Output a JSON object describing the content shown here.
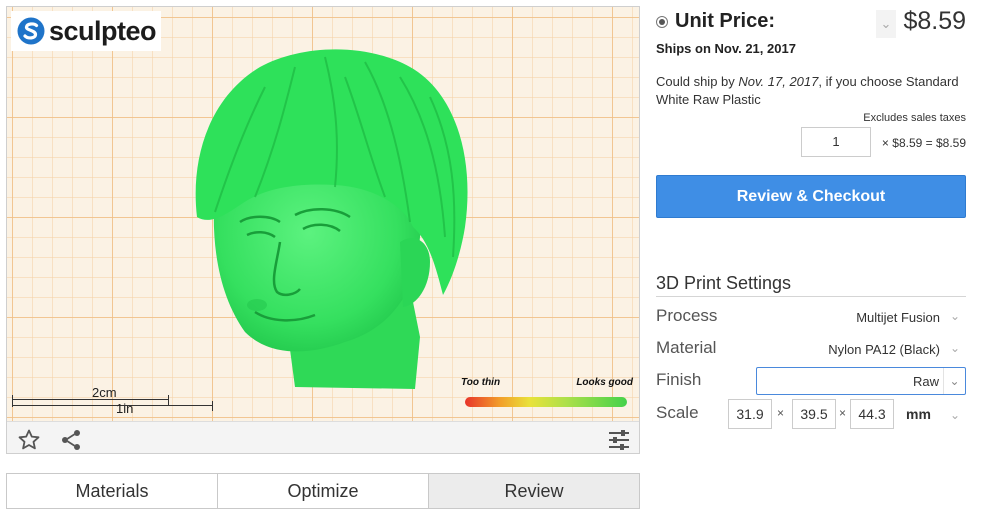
{
  "brand": {
    "name": "sculpteo"
  },
  "viewer": {
    "ruler": {
      "metric_label": "2cm",
      "imperial_label": "1in"
    },
    "thickness_legend": {
      "low_label": "Too thin",
      "high_label": "Looks good"
    },
    "toolbar": {
      "favorite_icon": "star-icon",
      "share_icon": "share-icon",
      "settings_icon": "sliders-icon"
    }
  },
  "tabs": [
    {
      "label": "Materials"
    },
    {
      "label": "Optimize"
    },
    {
      "label": "Review"
    }
  ],
  "pricing": {
    "unit_label": "Unit Price:",
    "unit_price": "$8.59",
    "ships": "Ships on Nov. 21, 2017",
    "could_prefix": "Could ship by ",
    "could_date": "Nov. 17, 2017",
    "could_suffix": ", if you choose Standard White Raw Plastic",
    "tax_note": "Excludes sales taxes",
    "quantity": "1",
    "formula": "× $8.59 = $8.59",
    "checkout_label": "Review & Checkout"
  },
  "settings": {
    "title": "3D Print Settings",
    "process": {
      "label": "Process",
      "value": "Multijet Fusion"
    },
    "material": {
      "label": "Material",
      "value": "Nylon PA12 (Black)"
    },
    "finish": {
      "label": "Finish",
      "value": "Raw"
    },
    "scale": {
      "label": "Scale",
      "x": "31.9",
      "y": "39.5",
      "z": "44.3",
      "times": "×",
      "unit": "mm"
    }
  },
  "colors": {
    "accent": "#3f8ee5",
    "model": "#33e86a",
    "brand_blue": "#1f74c9"
  }
}
